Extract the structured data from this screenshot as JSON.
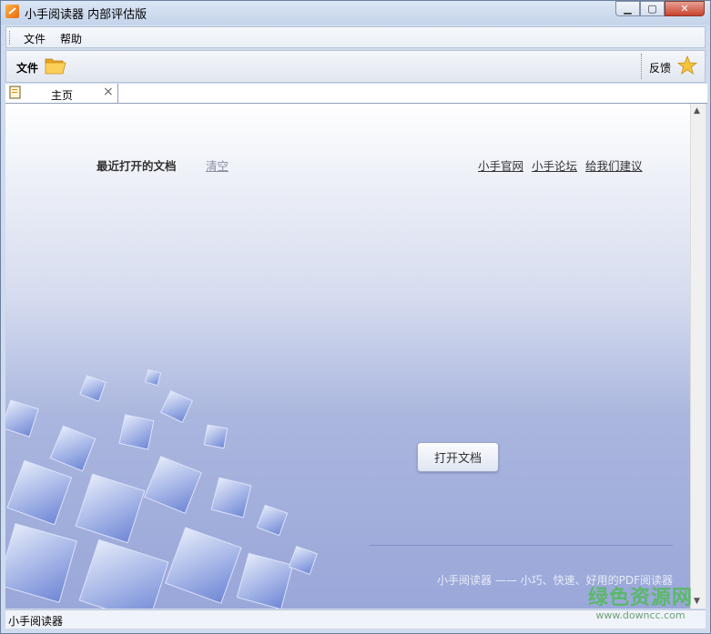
{
  "window": {
    "title": "小手阅读器 内部评估版"
  },
  "menubar": {
    "items": [
      "文件",
      "帮助"
    ]
  },
  "toolbar": {
    "file_label": "文件",
    "feedback_label": "反馈"
  },
  "tabs": [
    {
      "label": "主页"
    }
  ],
  "home": {
    "recent_label": "最近打开的文档",
    "clear_label": "清空",
    "links": [
      "小手官网",
      "小手论坛",
      "给我们建议"
    ],
    "open_button": "打开文档",
    "slogan": "小手阅读器 —— 小巧、快速、好用的PDF阅读器"
  },
  "statusbar": {
    "text": "小手阅读器"
  },
  "watermark": {
    "main": "绿色资源网",
    "sub": "www.downcc.com"
  },
  "colors": {
    "accent": "#9aa7d9",
    "watermark": "#5bb86a"
  }
}
